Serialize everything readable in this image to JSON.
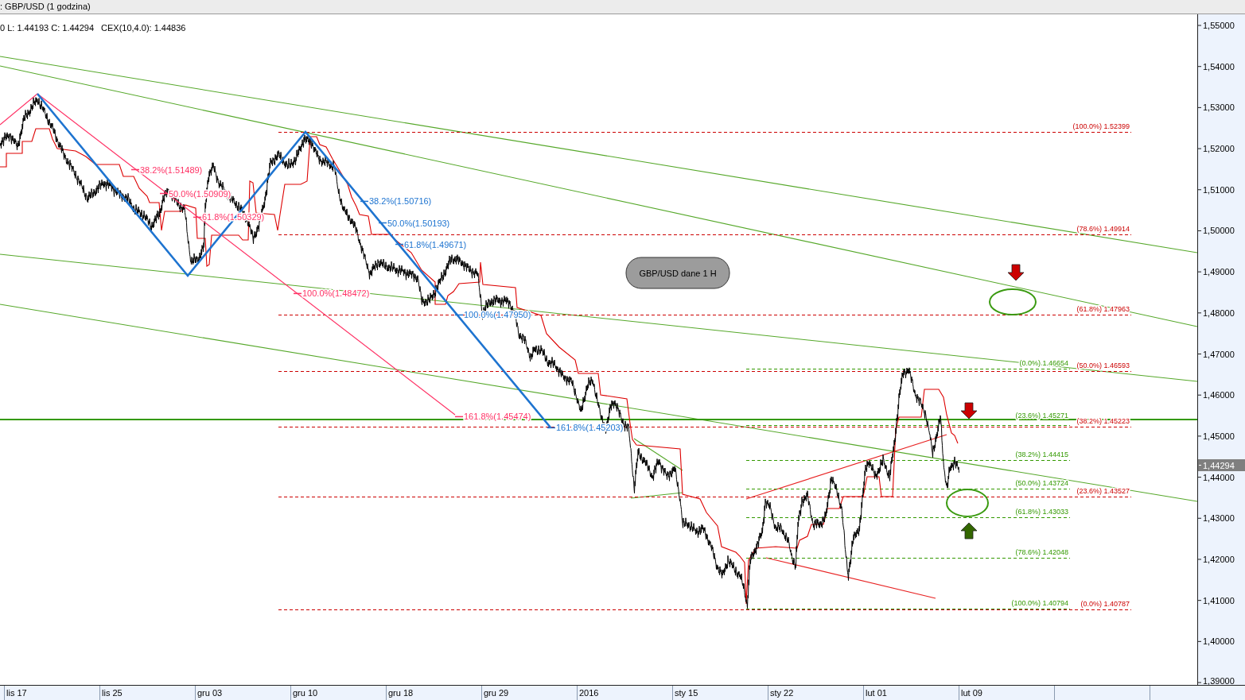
{
  "window": {
    "title": ": GBP/USD (1 godzina)"
  },
  "readouts": [
    "0 L: 1.44193 C: 1.44294",
    "CEX(10,4.0): 1.44836"
  ],
  "chart": {
    "note": "GBP/USD dane 1 H",
    "fibonacci_tools": [
      {
        "kind": "projection",
        "color": "#ff3366",
        "levels": [
          "38.2%(1.51489)",
          "50.0%(1.50909)",
          "61.8%(1.50329)",
          "100.0%(1.48472)",
          "161.8%(1.45474)"
        ]
      },
      {
        "kind": "projection",
        "color": "#1e74d0",
        "levels": [
          "38.2%(1.50716)",
          "50.0%(1.50193)",
          "61.8%(1.49671)",
          "100.0%(1.47950)",
          "161.8%(1.45203)"
        ]
      },
      {
        "kind": "retracement",
        "color": "#339900",
        "levels": [
          "(0.0%) 1.46654",
          "(23.6%) 1.45271",
          "(38.2%) 1.44415",
          "(50.0%) 1.43724",
          "(61.8%) 1.43033",
          "(78.6%) 1.42048",
          "(100.0%) 1.40794"
        ]
      },
      {
        "kind": "retracement",
        "color": "#cc0000",
        "levels": [
          "(100.0%) 1.52399",
          "(78.6%) 1.49914",
          "(61.8%) 1.47963",
          "(50.0%) 1.46593",
          "(38.2%) 1.45223",
          "(23.6%) 1.43527",
          "(0.0%) 1.40787"
        ]
      }
    ],
    "arrows": [
      {
        "kind": "down",
        "color": "#cc0000"
      },
      {
        "kind": "down",
        "color": "#cc0000"
      },
      {
        "kind": "up",
        "color": "#336600"
      }
    ],
    "price_axis": {
      "ticks": [
        "1,55000",
        "1,54000",
        "1,53000",
        "1,52000",
        "1,51000",
        "1,50000",
        "1,49000",
        "1,48000",
        "1,47000",
        "1,46000",
        "1,45000",
        "1,44000",
        "1,43000",
        "1,42000",
        "1,41000",
        "1,40000",
        "1,39000"
      ],
      "current_price": "1,44294"
    },
    "time_axis": {
      "labels": [
        "lis 17",
        "lis 25",
        "gru 03",
        "gru 10",
        "gru 18",
        "gru 29",
        "2016",
        "sty 15",
        "sty 22",
        "lut 01",
        "lut 09"
      ]
    }
  }
}
